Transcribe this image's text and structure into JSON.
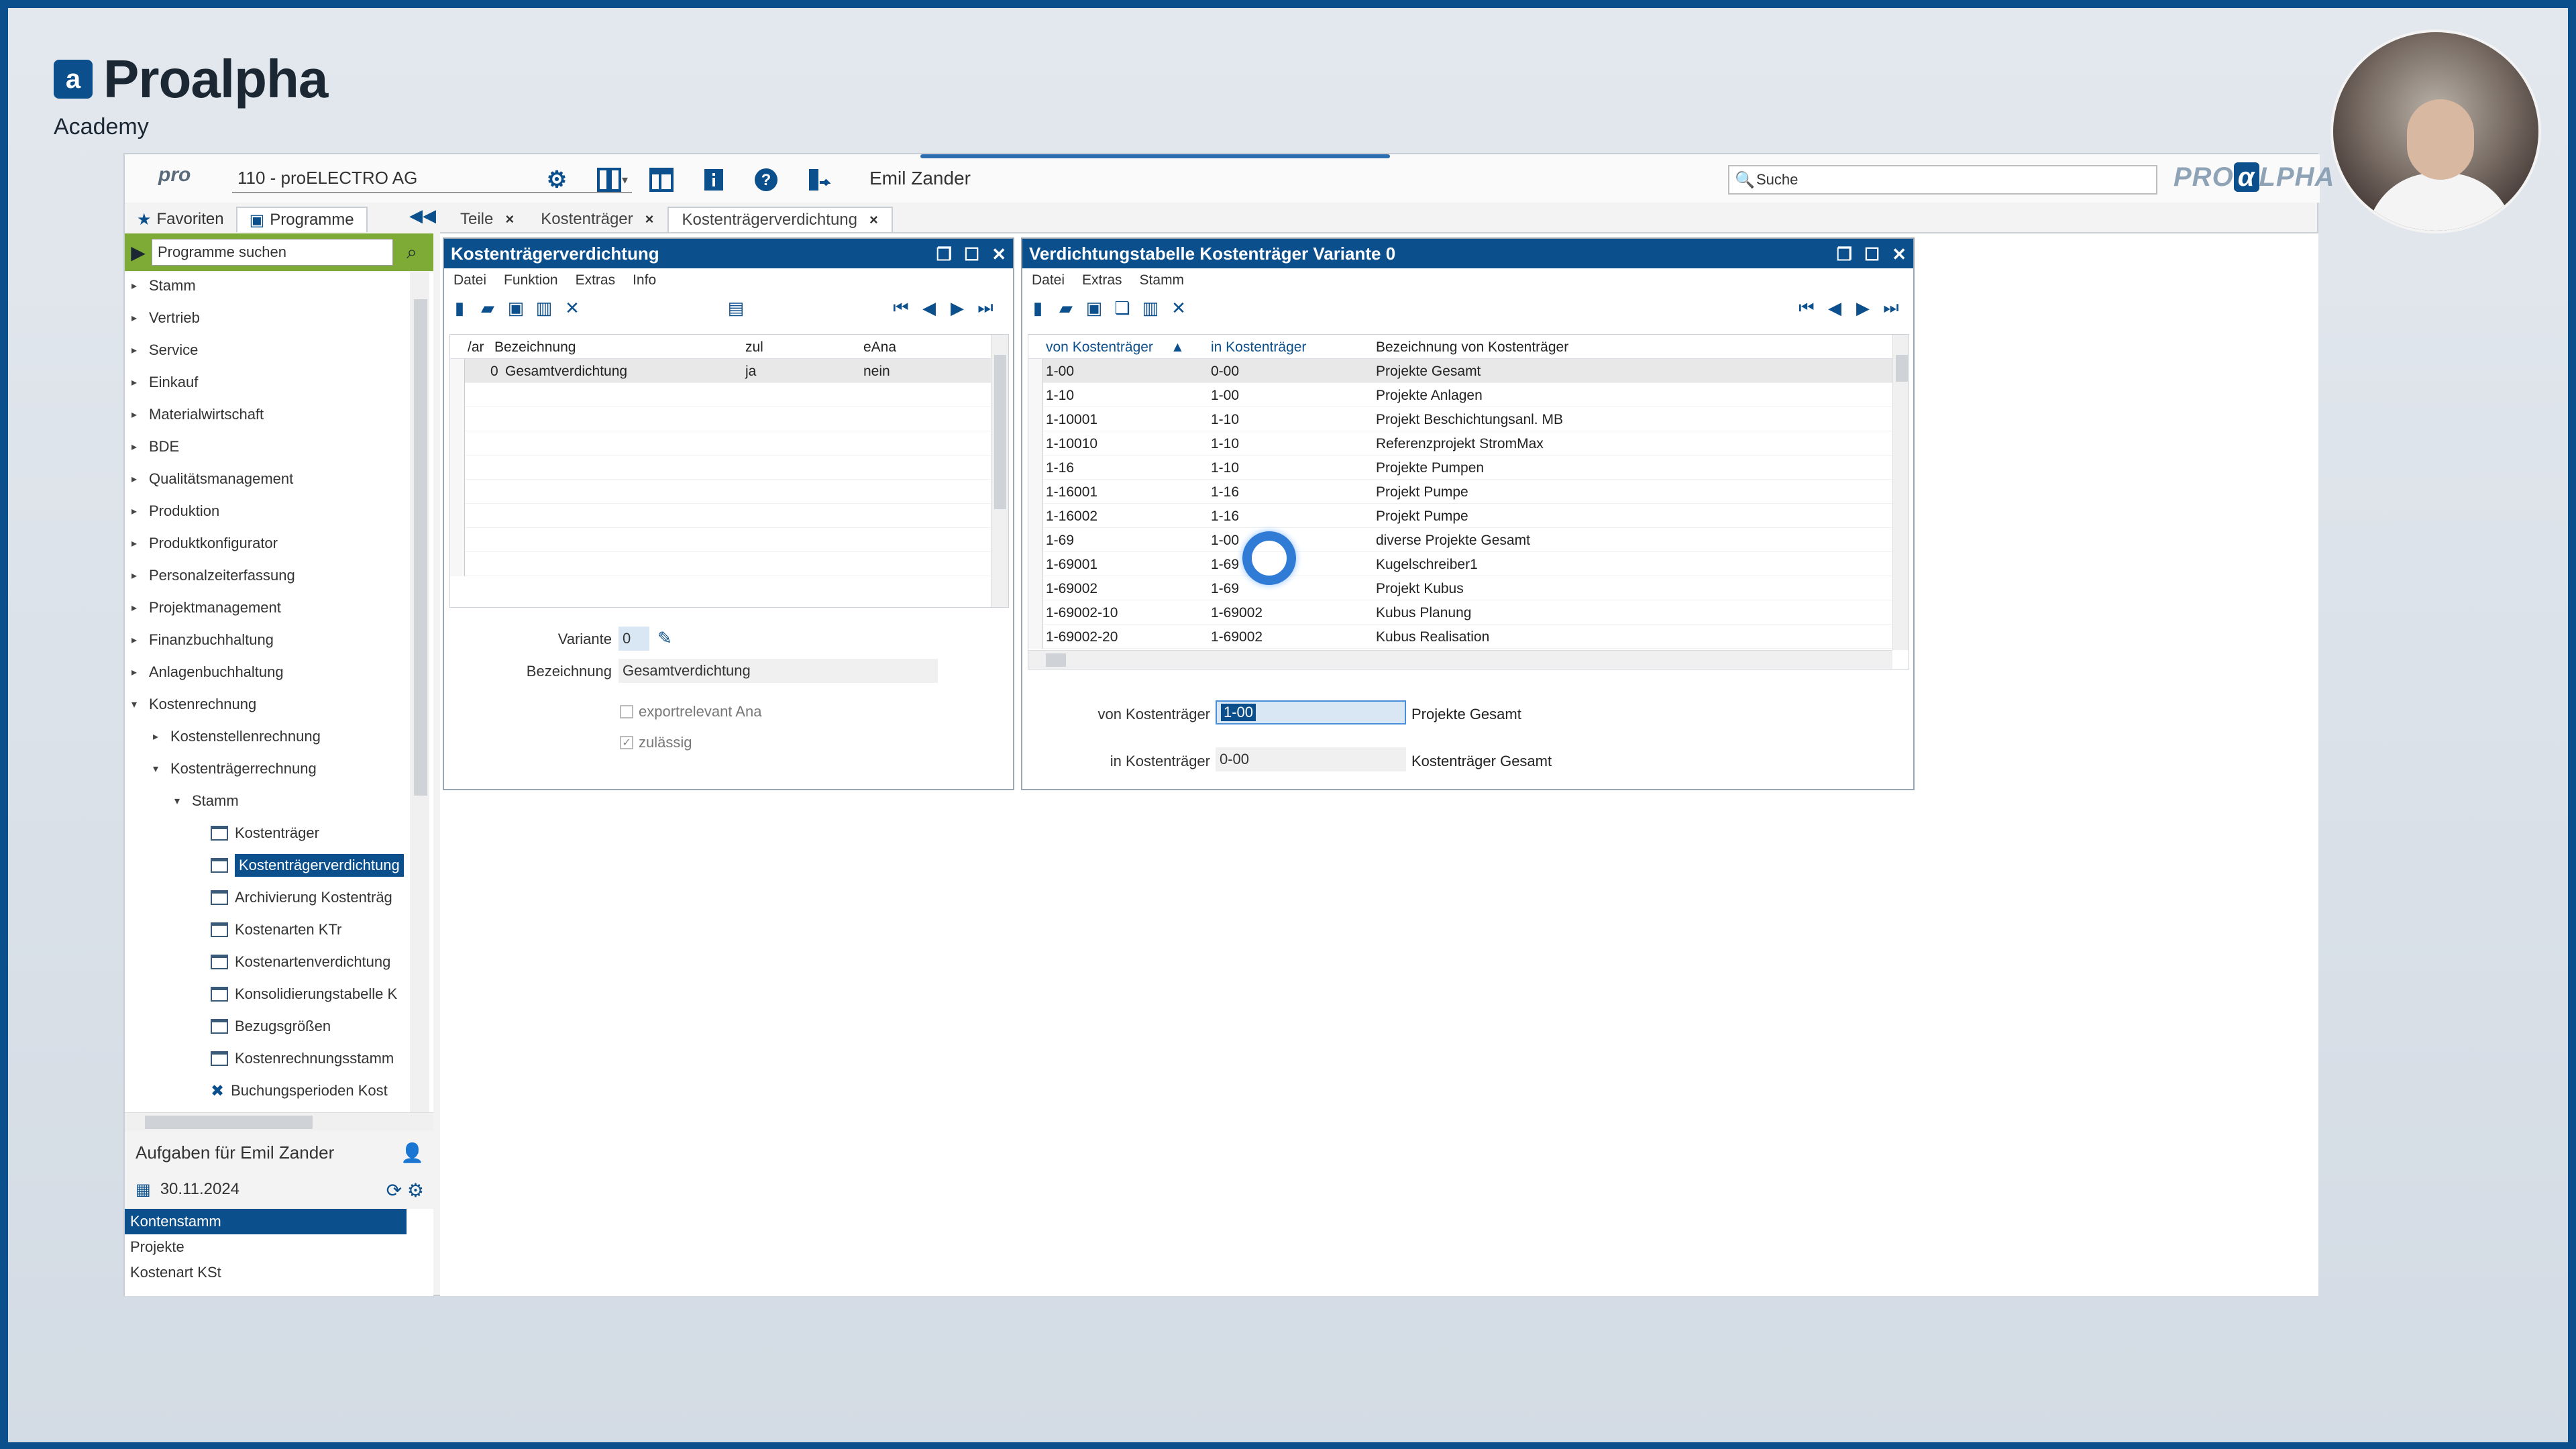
{
  "brand": {
    "title": "Proalpha",
    "subtitle": "Academy",
    "logo_glyph": "a"
  },
  "toolbar": {
    "pro_logo": "pro",
    "company": "110 - proELECTRO AG",
    "user": "Emil Zander",
    "search_placeholder": "Suche",
    "logo_left": "PRO",
    "logo_mid": "α",
    "logo_right": "LPHA"
  },
  "nav": {
    "tabs": [
      {
        "label": "Favoriten"
      },
      {
        "label": "Programme"
      }
    ],
    "search_placeholder": "Programme suchen",
    "tree": [
      {
        "label": "Stamm"
      },
      {
        "label": "Vertrieb"
      },
      {
        "label": "Service"
      },
      {
        "label": "Einkauf"
      },
      {
        "label": "Materialwirtschaft"
      },
      {
        "label": "BDE"
      },
      {
        "label": "Qualitätsmanagement"
      },
      {
        "label": "Produktion"
      },
      {
        "label": "Produktkonfigurator"
      },
      {
        "label": "Personalzeiterfassung"
      },
      {
        "label": "Projektmanagement"
      },
      {
        "label": "Finanzbuchhaltung"
      },
      {
        "label": "Anlagenbuchhaltung"
      },
      {
        "label": "Kostenrechnung"
      },
      {
        "label": "Kostenstellenrechnung"
      },
      {
        "label": "Kostenträgerrechnung"
      },
      {
        "label": "Stamm"
      },
      {
        "label": "Kostenträger"
      },
      {
        "label": "Kostenträgerverdichtung"
      },
      {
        "label": "Archivierung Kostenträg"
      },
      {
        "label": "Kostenarten KTr"
      },
      {
        "label": "Kostenartenverdichtung"
      },
      {
        "label": "Konsolidierungstabelle K"
      },
      {
        "label": "Bezugsgrößen"
      },
      {
        "label": "Kostenrechnungsstamm"
      },
      {
        "label": "Buchungsperioden Kost"
      }
    ]
  },
  "tasks": {
    "title": "Aufgaben für Emil Zander",
    "date": "30.11.2024",
    "items": [
      {
        "label": "Kontenstamm"
      },
      {
        "label": "Projekte"
      },
      {
        "label": "Kostenart KSt"
      }
    ]
  },
  "doc_tabs": [
    {
      "label": "Teile"
    },
    {
      "label": "Kostenträger"
    },
    {
      "label": "Kostenträgerverdichtung"
    }
  ],
  "panel1": {
    "title": "Kostenträgerverdichtung",
    "menu": [
      "Datei",
      "Funktion",
      "Extras",
      "Info"
    ],
    "columns": [
      "/ar",
      "Bezeichnung",
      "zul",
      "eAna"
    ],
    "rows": [
      {
        "var": "0",
        "bez": "Gesamtverdichtung",
        "zul": "ja",
        "eana": "nein"
      }
    ],
    "form": {
      "variante_label": "Variante",
      "variante_value": "0",
      "bezeichnung_label": "Bezeichnung",
      "bezeichnung_value": "Gesamtverdichtung",
      "export_label": "exportrelevant Ana",
      "zulaessig_label": "zulässig"
    }
  },
  "panel2": {
    "title": "Verdichtungstabelle Kostenträger Variante 0",
    "menu": [
      "Datei",
      "Extras",
      "Stamm"
    ],
    "columns": [
      "von Kostenträger",
      "in Kostenträger",
      "Bezeichnung von Kostenträger"
    ],
    "rows": [
      {
        "von": "1-00",
        "in": "0-00",
        "bez": "Projekte Gesamt"
      },
      {
        "von": "1-10",
        "in": "1-00",
        "bez": "Projekte Anlagen"
      },
      {
        "von": "1-10001",
        "in": "1-10",
        "bez": "Projekt Beschichtungsanl. MB"
      },
      {
        "von": "1-10010",
        "in": "1-10",
        "bez": "Referenzprojekt StromMax"
      },
      {
        "von": "1-16",
        "in": "1-10",
        "bez": "Projekte Pumpen"
      },
      {
        "von": "1-16001",
        "in": "1-16",
        "bez": "Projekt Pumpe"
      },
      {
        "von": "1-16002",
        "in": "1-16",
        "bez": "Projekt Pumpe"
      },
      {
        "von": "1-69",
        "in": "1-00",
        "bez": "diverse Projekte Gesamt"
      },
      {
        "von": "1-69001",
        "in": "1-69",
        "bez": "Kugelschreiber1"
      },
      {
        "von": "1-69002",
        "in": "1-69",
        "bez": "Projekt Kubus"
      },
      {
        "von": "1-69002-10",
        "in": "1-69002",
        "bez": "Kubus Planung"
      },
      {
        "von": "1-69002-20",
        "in": "1-69002",
        "bez": "Kubus Realisation"
      }
    ],
    "form": {
      "von_label": "von Kostenträger",
      "von_value": "1-00",
      "von_desc": "Projekte Gesamt",
      "in_label": "in Kostenträger",
      "in_value": "0-00",
      "in_desc": "Kostenträger Gesamt"
    }
  },
  "colors": {
    "accent": "#0b4f8c",
    "search_green": "#7dab36",
    "spinner": "#2f7bd6"
  }
}
